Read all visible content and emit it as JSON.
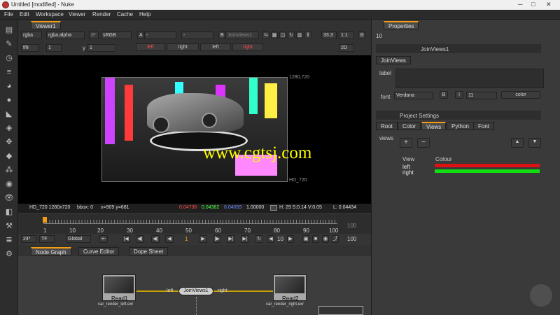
{
  "window": {
    "title": "Untitled [modified] - Nuke"
  },
  "menu": [
    "File",
    "Edit",
    "Workspace",
    "Viewer",
    "Render",
    "Cache",
    "Help"
  ],
  "viewer_tab": "Viewer1",
  "viewer_controls": {
    "channels": "rgba",
    "alpha": "rgba.alpha",
    "ip": "IP",
    "colorspace": "sRGB",
    "a_input": "A",
    "a_value": "-",
    "b_value": "-",
    "b_input": "B",
    "node": "JoinViews1",
    "zoom": "33.3",
    "ratio": "1:1",
    "fstop": "f/8",
    "frame_field": "1",
    "y_label": "y",
    "y_value": "1",
    "views": [
      "left",
      "right",
      "left",
      "right"
    ],
    "mode": "2D"
  },
  "image": {
    "resolution_top": "1280,720",
    "format_label": "HD_720",
    "watermark": "www.cgtsj.com"
  },
  "info": {
    "format": "HD_720 1280x720",
    "bbox": "bbox: 0",
    "coords": "x=909 y=681",
    "r": "0.04736",
    "g": "0.04382",
    "b": "0.04059",
    "a": "1.00000",
    "hsv": "H: 29 S:0.14 V:0.05",
    "l": "L: 0.04434"
  },
  "timeline": {
    "ticks": [
      "1",
      "10",
      "20",
      "30",
      "40",
      "50",
      "60",
      "70",
      "80",
      "90",
      "100"
    ],
    "end": "100",
    "fps": "24*",
    "tf": "TF",
    "range": "Global",
    "current": "1",
    "step": "10",
    "out": "100"
  },
  "bottom_tabs": [
    "Node Graph",
    "Curve Editor",
    "Dope Sheet"
  ],
  "nodes": {
    "read1": {
      "name": "Read1",
      "file": "car_render_left.exr"
    },
    "read2": {
      "name": "Read2",
      "file": "car_render_right.exr"
    },
    "join": {
      "name": "JoinViews1",
      "left": "left",
      "right": "right"
    }
  },
  "properties": {
    "tab": "Properties",
    "count": "10",
    "join_panel": {
      "node": "JoinViews1",
      "tab": "JoinViews",
      "label_field": "label",
      "font_label": "font",
      "font": "Verdana",
      "font_b": "B",
      "font_i": "I",
      "font_size": "11",
      "color_label": "color"
    },
    "project": {
      "title": "Project Settings",
      "tabs": [
        "Root",
        "Color",
        "Views",
        "Python",
        "Font"
      ],
      "active_tab": "Views",
      "views_label": "views",
      "add": "+",
      "remove": "−",
      "table_headers": [
        "View",
        "Colour"
      ],
      "rows": [
        {
          "view": "left",
          "color": "#dd1111"
        },
        {
          "view": "right",
          "color": "#11dd11"
        }
      ]
    }
  },
  "colors": {
    "accent": "#f39c12",
    "red": "#ff4a4a",
    "green": "#4aff4a",
    "blue": "#6a6aff"
  }
}
